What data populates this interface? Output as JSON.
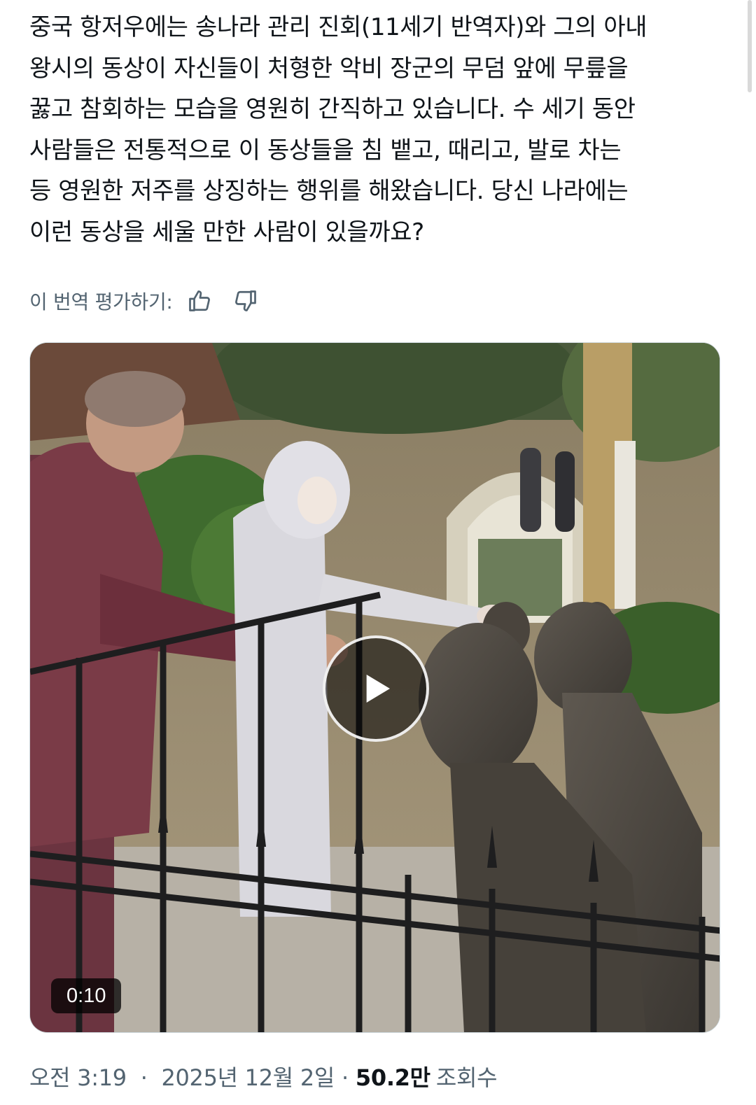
{
  "tweet": {
    "text": "중국 항저우에는 송나라 관리 진회(11세기 반역자)와 그의 아내\n왕시의 동상이 자신들이 처형한 악비 장군의 무덤 앞에 무릎을\n꿇고 참회하는 모습을 영원히 간직하고 있습니다. 수 세기 동안\n사람들은 전통적으로 이 동상들을 침 뱉고, 때리고, 발로 차는\n등 영원한 저주를 상징하는 행위를 해왔습니다. 당신 나라에는\n이런 동상을 세울 만한 사람이 있을까요?"
  },
  "translation_rating": {
    "label": "이 번역 평가하기:",
    "icons": [
      "thumbs-up-icon",
      "thumbs-down-icon"
    ]
  },
  "video": {
    "duration": "0:10",
    "icons": [
      "play-icon"
    ]
  },
  "meta": {
    "time": "오전 3:19",
    "separator": "·",
    "date": "2025년 12월 2일",
    "views_count": "50.2만",
    "views_label": "조회수"
  },
  "colors": {
    "text": "#0f1419",
    "secondary": "#536471",
    "border": "#cfd9de"
  }
}
